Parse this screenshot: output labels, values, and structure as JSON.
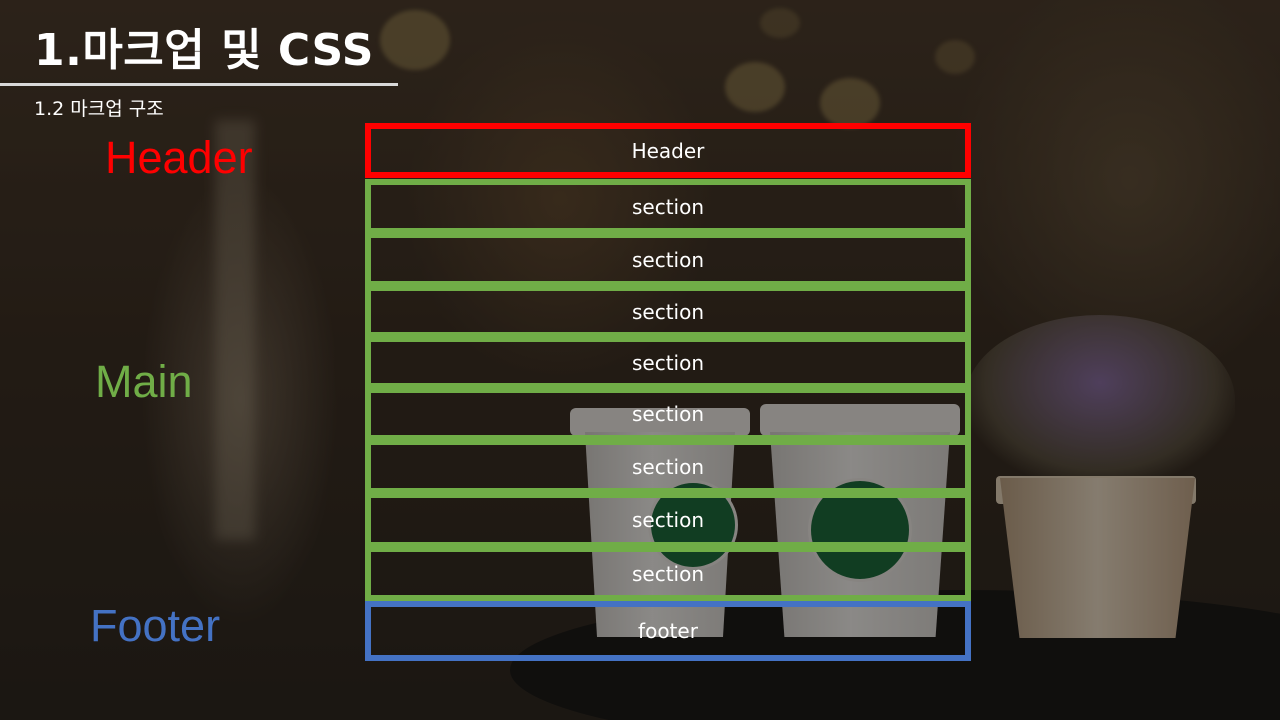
{
  "slide": {
    "title": "1.마크업 및 CSS",
    "subtitle": "1.2 마크업 구조"
  },
  "labels": {
    "header": "Header",
    "main": "Main",
    "footer": "Footer"
  },
  "diagram": {
    "header_box": "Header",
    "sections": [
      "section",
      "section",
      "section",
      "section",
      "section",
      "section",
      "section",
      "section"
    ],
    "footer_box": "footer"
  },
  "colors": {
    "header": "#ff0000",
    "main": "#70ad47",
    "footer": "#4472c4"
  }
}
